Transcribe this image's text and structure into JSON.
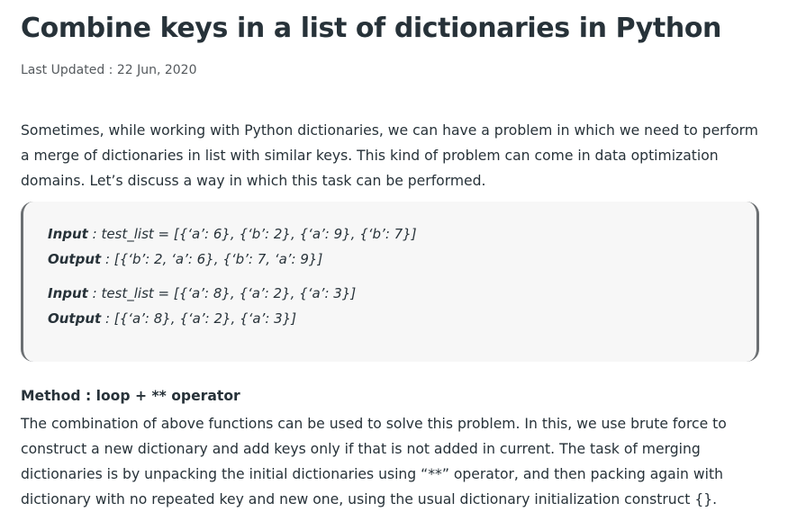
{
  "article": {
    "title": "Combine keys in a list of dictionaries in Python",
    "last_updated": "Last Updated : 22 Jun, 2020",
    "intro": "Sometimes, while working with Python dictionaries, we can have a problem in which we need to perform a merge of dictionaries in list with similar keys. This kind of problem can come in data optimization domains. Let’s discuss a way in which this task can be performed.",
    "examples": [
      {
        "input_label": "Input",
        "input_value": " : test_list = [{‘a’: 6}, {‘b’: 2}, {‘a’: 9}, {‘b’: 7}]",
        "output_label": "Output",
        "output_value": " : [{‘b’: 2, ‘a’: 6}, {‘b’: 7, ‘a’: 9}]"
      },
      {
        "input_label": "Input",
        "input_value": " : test_list = [{‘a’: 8}, {‘a’: 2}, {‘a’: 3}]",
        "output_label": "Output",
        "output_value": " : [{‘a’: 8}, {‘a’: 2}, {‘a’: 3}]"
      }
    ],
    "method_title": "Method : loop + ** operator",
    "method_body": "The combination of above functions can be used to solve this problem. In this, we use brute force to construct a new dictionary and add keys only if that is not added in current. The task of merging dictionaries is by unpacking the initial dictionaries using “**” operator, and then packing again with dictionary with no repeated key and new one, using the usual dictionary initialization construct {}."
  },
  "colors": {
    "text": "#273239",
    "muted": "#555a5e",
    "box_background": "#f7f7f7",
    "box_border": "#6b6f72"
  }
}
